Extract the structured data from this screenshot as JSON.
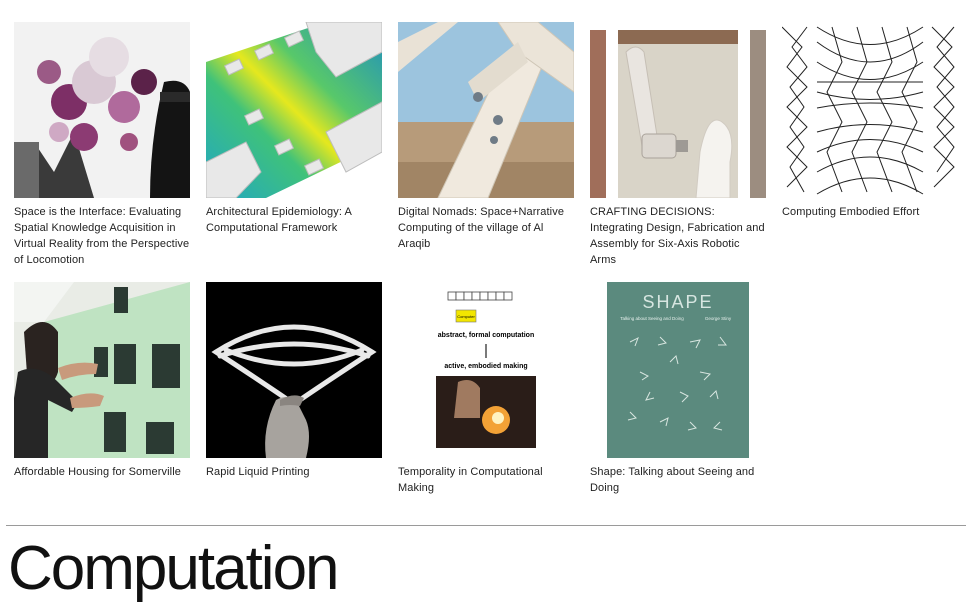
{
  "projects": [
    {
      "title": "Space is the Interface: Evaluating Spatial Knowledge Acquisition in Virtual Reality from the Perspective of Locomotion"
    },
    {
      "title": "Architectural Epidemiology: A Computational Framework"
    },
    {
      "title": "Digital Nomads: Space+Narrative Computing of the village of Al Araqib"
    },
    {
      "title": "CRAFTING DECISIONS: Integrating Design, Fabrication and Assembly for Six-Axis Robotic Arms"
    },
    {
      "title": "Computing Embodied Effort"
    },
    {
      "title": "Affordable Housing for Somerville"
    },
    {
      "title": "Rapid Liquid Printing"
    },
    {
      "title": "Temporality in Computational Making",
      "thumb_text": {
        "box": "Computer",
        "top": "abstract, formal computation",
        "bottom": "active, embodied making"
      }
    },
    {
      "title": "Shape: Talking about Seeing and Doing",
      "thumb_text": {
        "word": "SHAPE",
        "subtitle": "Talking about Seeing and Doing",
        "author": "George Stiny"
      }
    }
  ],
  "section": {
    "title": "Computation"
  }
}
